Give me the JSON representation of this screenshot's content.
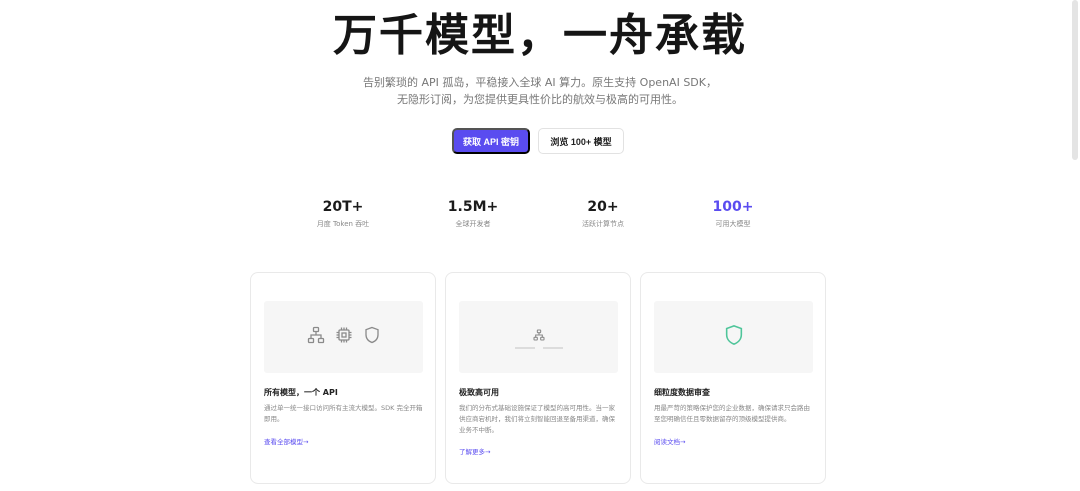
{
  "hero": {
    "title": "万千模型，一舟承载",
    "subtitle_line1": "告别繁琐的 API 孤岛，平稳接入全球 AI 算力。原生支持 OpenAI SDK，",
    "subtitle_line2": "无隐形订阅，为您提供更具性价比的航效与极高的可用性。"
  },
  "cta": {
    "primary_label": "获取 API 密钥",
    "secondary_label": "浏览 100+ 模型"
  },
  "stats": [
    {
      "value": "20T+",
      "label": "月度 Token 吞吐"
    },
    {
      "value": "1.5M+",
      "label": "全球开发者"
    },
    {
      "value": "20+",
      "label": "活跃计算节点"
    },
    {
      "value": "100+",
      "label": "可用大模型"
    }
  ],
  "colors": {
    "accent": "#5a4cf0",
    "shield_green": "#4fc59a"
  },
  "cards": [
    {
      "title": "所有模型，一个 API",
      "desc": "通过单一统一接口访问所有主流大模型。SDK 完全开箱即用。",
      "link": "查看全部模型→",
      "icons": [
        "network-icon",
        "chip-icon",
        "shield-icon"
      ]
    },
    {
      "title": "极致高可用",
      "desc": "我们的分布式基础设施保证了模型的高可用性。当一家供应商宕机时，我们将立刻智能回退至备用渠道，确保业务不中断。",
      "link": "了解更多→",
      "icons": [
        "network-icon"
      ]
    },
    {
      "title": "细粒度数据审查",
      "desc": "用最严苛的策略保护您的企业数据，确保请求只会路由至您明确信任且零数据留存的顶级模型提供商。",
      "link": "阅读文档→",
      "icons": [
        "shield-icon"
      ]
    }
  ]
}
